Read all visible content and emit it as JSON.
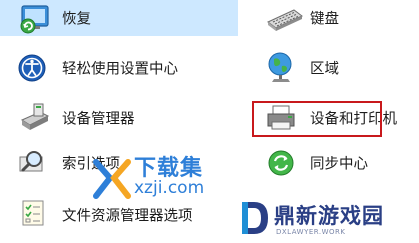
{
  "items": {
    "recovery": {
      "label": "恢复",
      "icon": "recovery-icon"
    },
    "keyboard": {
      "label": "键盘",
      "icon": "keyboard-icon"
    },
    "ease_of_access": {
      "label": "轻松使用设置中心",
      "icon": "ease-of-access-icon"
    },
    "region": {
      "label": "区域",
      "icon": "globe-icon"
    },
    "device_manager": {
      "label": "设备管理器",
      "icon": "device-manager-icon"
    },
    "devices_printers": {
      "label": "设备和打印机",
      "icon": "printer-icon"
    },
    "indexing": {
      "label": "索引选项",
      "icon": "indexing-icon"
    },
    "sync_center": {
      "label": "同步中心",
      "icon": "sync-icon"
    },
    "file_explorer_options": {
      "label": "文件资源管理器选项",
      "icon": "folder-options-icon"
    }
  },
  "watermarks": {
    "xzji_title": "下载集",
    "xzji_url": "xzji.com",
    "dx_title": "鼎新游戏园",
    "dx_sub": "DXLAWYER.WORK"
  },
  "colors": {
    "selection": "#cde8ff",
    "highlight": "#c8191c",
    "watermark_blue": "#2e7fd8",
    "watermark_navy": "#2a3f85"
  }
}
